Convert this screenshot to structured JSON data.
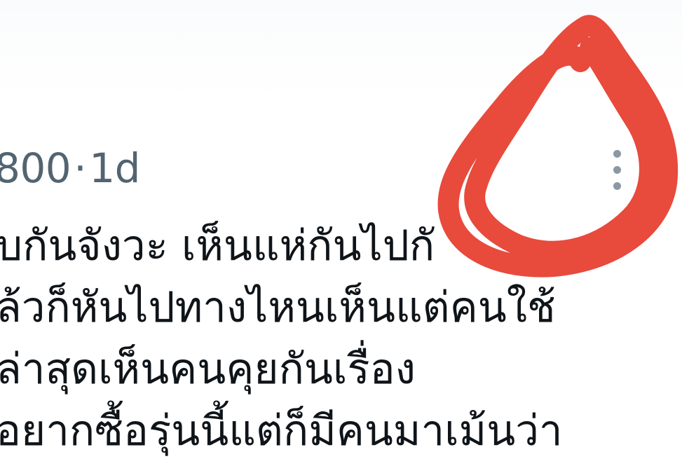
{
  "post": {
    "meta": {
      "handle_tail": "800",
      "separator": "·",
      "timestamp": "1d"
    },
    "body_lines": [
      "บกันจังวะ เห็นแห่กันไปกั",
      "ล้วก็หันไปทางไหนเห็นแต่คนใช้",
      "ล่าสุดเห็นคนคุยกันเรื่อง",
      "อยากซื้อรุ่นนี้แต่ก็มีคนมาเม้นว่า"
    ],
    "more_menu_icon": "more-vertical-icon"
  },
  "annotation": {
    "type": "hand-drawn-circle",
    "color": "#e84a3c"
  }
}
